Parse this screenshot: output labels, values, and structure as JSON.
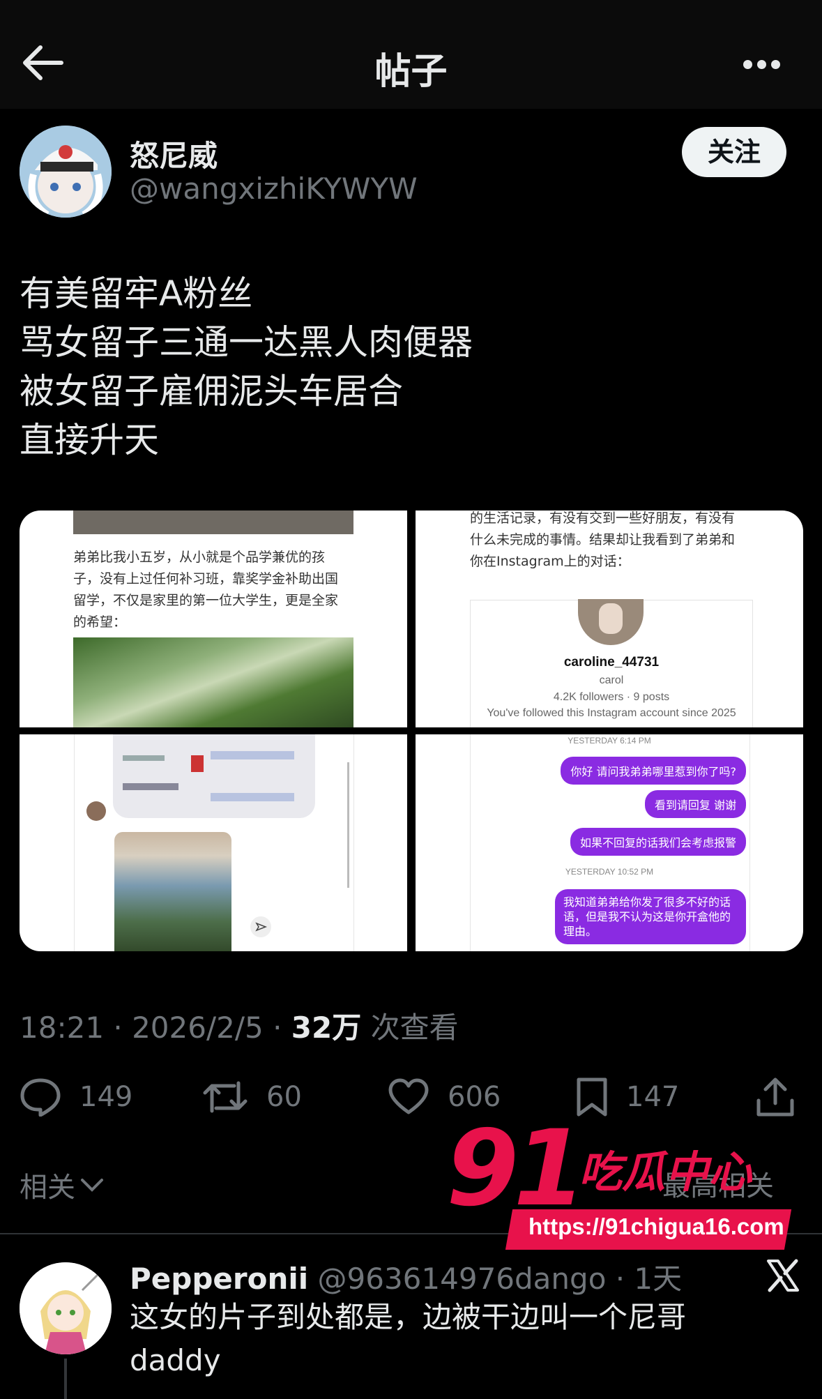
{
  "header": {
    "title": "帖子"
  },
  "author": {
    "name": "怒尼威",
    "handle": "@wangxizhiKYWYW",
    "follow_label": "关注"
  },
  "post": {
    "lines": [
      "有美留牢A粉丝",
      "骂女留子三通一达黑人肉便器",
      "被女留子雇佣泥头车居合",
      "直接升天"
    ]
  },
  "media": {
    "tile1": {
      "text": [
        "弟弟比我小五岁，从小就是个品学兼优的孩",
        "子，没有上过任何补习班，靠奖学金补助出国",
        "留学，不仅是家里的第一位大学生，更是全家",
        "的希望："
      ]
    },
    "tile2": {
      "text": [
        "的生活记录，有没有交到一些好朋友，有没有",
        "什么未完成的事情。结果却让我看到了弟弟和",
        "你在Instagram上的对话："
      ],
      "username": "caroline_44731",
      "display_name": "carol",
      "stats": "4.2K followers · 9 posts",
      "followed_since": "You've followed this Instagram account since 2025"
    },
    "tile4": {
      "time1": "YESTERDAY 6:14 PM",
      "msg1": "你好 请问我弟弟哪里惹到你了吗?",
      "msg2": "看到请回复 谢谢",
      "msg3": "如果不回复的话我们会考虑报警",
      "time2": "YESTERDAY 10:52 PM",
      "msg4": "我知道弟弟给你发了很多不好的话语，但是我不认为这是你开盒他的理由。"
    }
  },
  "meta": {
    "time": "18:21 · 2026/2/5 · ",
    "views": "32万",
    "views_label": " 次查看"
  },
  "actions": {
    "replies": "149",
    "retweets": "60",
    "likes": "606",
    "bookmarks": "147"
  },
  "related": {
    "label": "相关",
    "right_label": "最高相关"
  },
  "watermark": {
    "number": "91",
    "name": "吃瓜中心",
    "url": "https://91chigua16.com"
  },
  "reply": {
    "name": "Pepperonii",
    "handle": "@963614976dango · 1天",
    "text": "这女的片子到处都是，边被干边叫一个尼哥daddy"
  },
  "colors": {
    "background": "#000000",
    "secondary_text": "#71767b",
    "watermark": "#e8124b",
    "chat_bubble": "#8a2be2"
  }
}
